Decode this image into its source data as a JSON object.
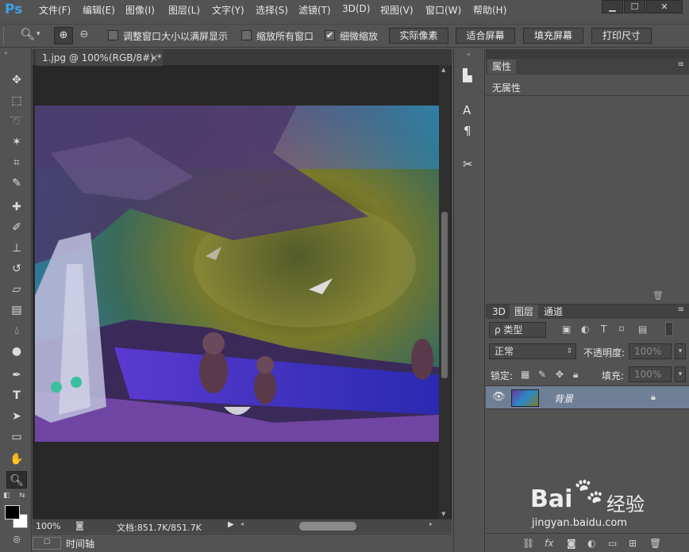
{
  "app": {
    "logo": "Ps",
    "menus": [
      "文件(F)",
      "编辑(E)",
      "图像(I)",
      "图层(L)",
      "文字(Y)",
      "选择(S)",
      "滤镜(T)",
      "3D(D)",
      "视图(V)",
      "窗口(W)",
      "帮助(H)"
    ],
    "window_buttons": [
      "▁",
      "☐",
      "✕"
    ]
  },
  "options": {
    "resize_windows_label": "调整窗口大小以满屏显示",
    "zoom_all_label": "缩放所有窗口",
    "scrubby_zoom_label": "细微缩放",
    "actual_pixels": "实际像素",
    "fit_screen": "适合屏幕",
    "fill_screen": "填充屏幕",
    "print_size": "打印尺寸",
    "resize_windows_checked": false,
    "zoom_all_checked": false,
    "scrubby_zoom_checked": true
  },
  "document": {
    "tab_title": "1.jpg @ 100%(RGB/8#) *",
    "tab_close": "×",
    "zoom": "100%",
    "doc_info": "文档:851.7K/851.7K"
  },
  "timeline": {
    "label": "时间轴"
  },
  "properties": {
    "tab": "属性",
    "content": "无属性"
  },
  "layers": {
    "tabs": [
      "3D",
      "图层",
      "通道"
    ],
    "filter_kind": "ρ 类型",
    "blend_mode": "正常",
    "opacity_label": "不透明度:",
    "opacity_value": "100%",
    "lock_label": "锁定:",
    "fill_label": "填充:",
    "fill_value": "100%",
    "items": [
      {
        "name": "背景",
        "visible": true,
        "locked": true
      }
    ]
  },
  "watermark": {
    "brand": "Bai",
    "brand2": "经验",
    "url": "jingyan.baidu.com"
  },
  "colors": {
    "ui_bg": "#535353",
    "doc_bg": "#282828",
    "accent": "#3aa0e8"
  }
}
